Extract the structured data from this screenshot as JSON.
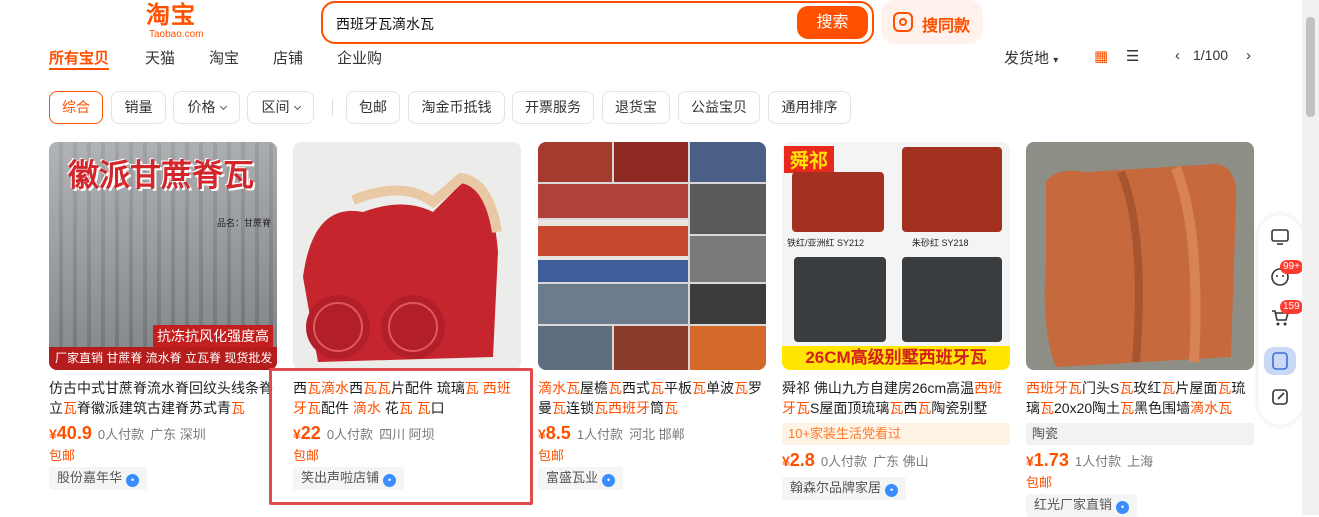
{
  "header": {
    "logo_cn": "淘宝",
    "logo_en": "Taobao.com",
    "search_query": "西班牙瓦滴水瓦",
    "search_button": "搜索",
    "image_search_label": "搜同款"
  },
  "tabs": [
    "所有宝贝",
    "天猫",
    "淘宝",
    "店铺",
    "企业购"
  ],
  "right_controls": {
    "ship_from": "发货地",
    "page": "1/100"
  },
  "filters": [
    "综合",
    "销量",
    "价格",
    "区间",
    "包邮",
    "淘金币抵钱",
    "开票服务",
    "退货宝",
    "公益宝贝",
    "通用排序"
  ],
  "products": [
    {
      "image_text": "徽派甘蔗脊瓦",
      "image_label": "品名：甘蔗脊",
      "image_banner": "抗冻抗风化强度高",
      "image_footer": "厂家直销 甘蔗脊 流水脊 立瓦脊 现货批发",
      "title_parts": [
        [
          "仿古中式甘蔗脊流水脊回纹头线条脊立",
          false
        ],
        [
          "瓦",
          true
        ],
        [
          "脊徽派建筑古建脊苏式青",
          false
        ],
        [
          "瓦",
          true
        ]
      ],
      "price_int": "40.9",
      "sales": "0人付款",
      "location": "广东 深圳",
      "free_ship": "包邮",
      "shop": "股份嘉年华"
    },
    {
      "title_parts": [
        [
          "西",
          false
        ],
        [
          "瓦滴水",
          true
        ],
        [
          "西",
          false
        ],
        [
          "瓦瓦",
          true
        ],
        [
          "片配件 琉璃",
          false
        ],
        [
          "瓦 西班牙瓦",
          true
        ],
        [
          "配件 ",
          false
        ],
        [
          "滴水",
          true
        ],
        [
          " 花",
          false
        ],
        [
          "瓦 瓦",
          true
        ],
        [
          "口",
          false
        ]
      ],
      "price_int": "22",
      "sales": "0人付款",
      "location": "四川 阿坝",
      "free_ship": "包邮",
      "shop": "笑出声啦店铺"
    },
    {
      "title_parts": [
        [
          "滴水瓦",
          true
        ],
        [
          "屋檐",
          false
        ],
        [
          "瓦",
          true
        ],
        [
          "西式",
          false
        ],
        [
          "瓦",
          true
        ],
        [
          "平板",
          false
        ],
        [
          "瓦",
          true
        ],
        [
          "单波",
          false
        ],
        [
          "瓦",
          true
        ],
        [
          "罗曼",
          false
        ],
        [
          "瓦",
          true
        ],
        [
          "连锁",
          false
        ],
        [
          "瓦西班牙",
          true
        ],
        [
          "筒",
          false
        ],
        [
          "瓦",
          true
        ]
      ],
      "price_int": "8.5",
      "sales": "1人付款",
      "location": "河北 邯郸",
      "free_ship": "包邮",
      "shop": "富盛瓦业"
    },
    {
      "image_brand": "舜祁",
      "image_label1": "铁红/亚洲红 SY212",
      "image_label2": "朱砂红 SY218",
      "image_banner": "26CM高级别墅西班牙瓦",
      "title_parts": [
        [
          "舜祁 佛山九方自建房26cm高温",
          false
        ],
        [
          "西班牙瓦",
          true
        ],
        [
          "S屋面顶琉璃",
          false
        ],
        [
          "瓦",
          true
        ],
        [
          "西",
          false
        ],
        [
          "瓦",
          true
        ],
        [
          "陶瓷别墅",
          false
        ]
      ],
      "tag": "10+家装生活党看过",
      "price_int": "2.8",
      "sales": "0人付款",
      "location": "广东 佛山",
      "shop": "翰森尔品牌家居"
    },
    {
      "title_parts": [
        [
          "西班牙瓦",
          true
        ],
        [
          "门头S",
          false
        ],
        [
          "瓦",
          true
        ],
        [
          "玫红",
          false
        ],
        [
          "瓦",
          true
        ],
        [
          "片屋面",
          false
        ],
        [
          "瓦",
          true
        ],
        [
          "琉璃",
          false
        ],
        [
          "瓦",
          true
        ],
        [
          "20x20陶土",
          false
        ],
        [
          "瓦",
          true
        ],
        [
          "黑色围墙",
          false
        ],
        [
          "滴水瓦",
          true
        ]
      ],
      "tag": "陶瓷",
      "price_int": "1.73",
      "sales": "1人付款",
      "location": "上海",
      "free_ship": "包邮",
      "shop": "红光厂家直销"
    }
  ],
  "sidebar_badges": [
    "99+",
    "159"
  ],
  "colors": {
    "accent": "#ff5000",
    "highlight_box": "#e04b4b"
  }
}
